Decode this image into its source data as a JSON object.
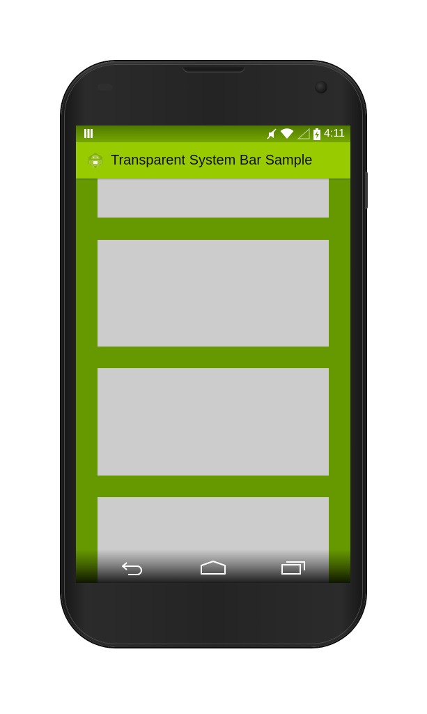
{
  "status_bar": {
    "notification_icon": "notification-icon",
    "icons": [
      "mute-icon",
      "wifi-icon",
      "signal-icon",
      "battery-charging-icon"
    ],
    "time": "4:11"
  },
  "action_bar": {
    "app_icon": "android-app-icon",
    "title": "Transparent System Bar Sample"
  },
  "cards": [
    {
      "name": "card-1"
    },
    {
      "name": "card-2"
    },
    {
      "name": "card-3"
    },
    {
      "name": "card-4"
    }
  ],
  "nav_bar": {
    "buttons": [
      "back-icon",
      "home-icon",
      "recents-icon"
    ]
  },
  "colors": {
    "background_green": "#669900",
    "action_bar_green": "#99cc00",
    "card_gray": "#cccccc"
  }
}
